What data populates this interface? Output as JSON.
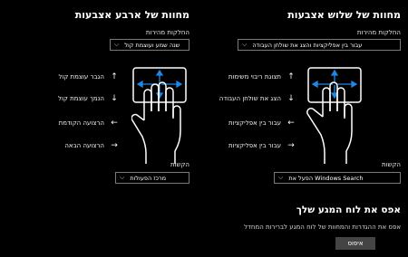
{
  "three": {
    "title": "מחוות של שלוש אצבעות",
    "taps_label": "החלקות מהירות",
    "taps_value": "עבור בין אפליקציות והצג את שולחן העבודה",
    "rows": [
      {
        "arrow": "↑",
        "text": "תצוגת ריבוי משימות"
      },
      {
        "arrow": "↓",
        "text": "הצג את שולחן העבודה"
      },
      {
        "arrow": "←",
        "text": "עבור בין אפליקציות"
      },
      {
        "arrow": "→",
        "text": "עבור בין אפליקציות"
      }
    ],
    "tap_label": "הקשות",
    "tap_value": "הפעל את Windows Search"
  },
  "four": {
    "title": "מחוות של ארבע אצבעות",
    "taps_label": "החלקות מהירות",
    "taps_value": "שנה שמע ועוצמת קול",
    "rows": [
      {
        "arrow": "↑",
        "text": "הגבר עוצמת קול"
      },
      {
        "arrow": "↓",
        "text": "הנמך עוצמת קול"
      },
      {
        "arrow": "←",
        "text": "הרצועה הקודמת"
      },
      {
        "arrow": "→",
        "text": "הרצועה הבאה"
      }
    ],
    "tap_label": "הקשות",
    "tap_value": "מרכז הפעולות"
  },
  "reset": {
    "title": "אפס את לוח המגע שלך",
    "desc": "אפס את ההגדרות והמחוות של לוח המגע לברירות המחדל",
    "button": "איפוס"
  },
  "icons": {
    "dropdown": "chevron-down-icon",
    "gesture": "hand-gesture-icon"
  },
  "colors": {
    "background": "#000000",
    "text": "#ffffff",
    "button": "#444444"
  }
}
